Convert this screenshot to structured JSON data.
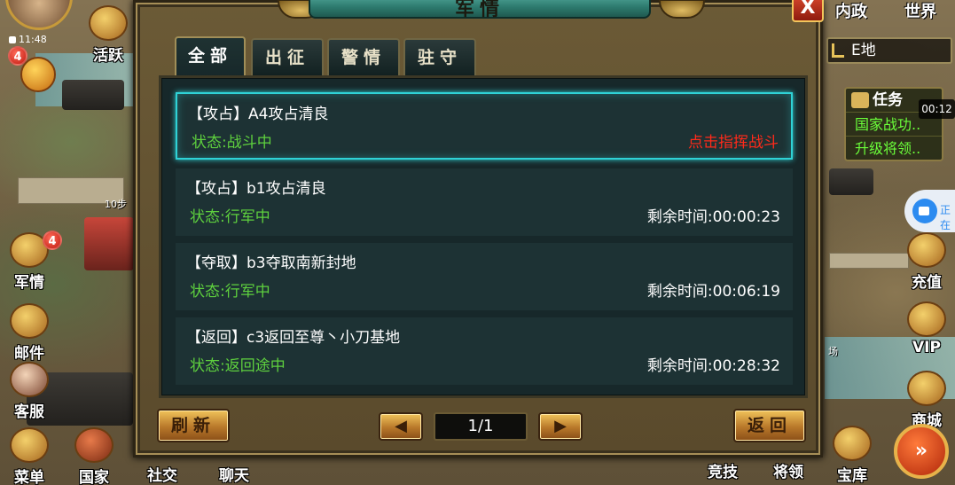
{
  "hud": {
    "clock": "11:48",
    "avatar_badge": "4",
    "activity_label": "活跃",
    "military_label": "军情",
    "military_badge": "4",
    "mail_label": "邮件",
    "service_label": "客服",
    "menu_label": "菜单",
    "country_label": "国家",
    "social_label": "社交",
    "chat_label": "聊天",
    "step_label": "10步",
    "internal_label": "内政",
    "world_label": "世界",
    "coord_text": "E地",
    "task_title": "任务",
    "task_lines": [
      "国家战功..",
      "升级将领.."
    ],
    "timer": "00:12",
    "record_label": "正在",
    "recharge_label": "充值",
    "vip_label": "VIP",
    "shop_label": "商城",
    "treasury_label": "宝库",
    "arena_label": "竞技",
    "general_label": "将领",
    "field_label": "场"
  },
  "dialog": {
    "title": "军情",
    "close": "X",
    "tabs": [
      "全部",
      "出征",
      "警情",
      "驻守"
    ],
    "active_tab": 0,
    "rows": [
      {
        "title": "【攻占】A4攻占清良",
        "status": "状态:战斗中",
        "right": "点击指挥战斗",
        "right_color": "red"
      },
      {
        "title": "【攻占】b1攻占清良",
        "status": "状态:行军中",
        "right": "剩余时间:00:00:23"
      },
      {
        "title": "【夺取】b3夺取南新封地",
        "status": "状态:行军中",
        "right": "剩余时间:00:06:19"
      },
      {
        "title": "【返回】c3返回至尊丶小刀基地",
        "status": "状态:返回途中",
        "right": "剩余时间:00:28:32"
      }
    ],
    "refresh_label": "刷新",
    "prev_icon": "◀",
    "next_icon": "▶",
    "page": "1/1",
    "back_label": "返回"
  }
}
